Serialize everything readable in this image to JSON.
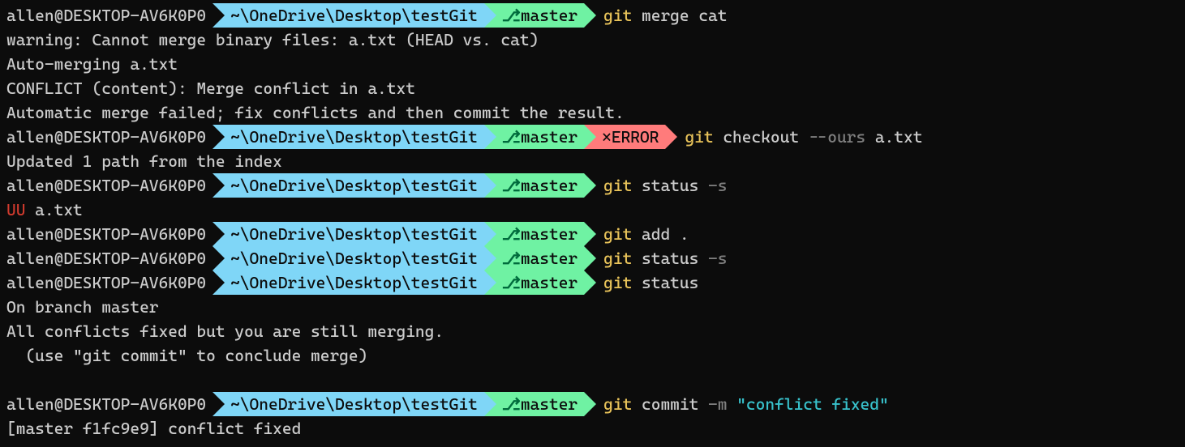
{
  "user": "allen@DESKTOP-AV6K0P0",
  "path": "~\\OneDrive\\Desktop\\testGit",
  "branch": "master",
  "error_badge": "⨯ERROR",
  "branch_glyph": "⎇",
  "cmds": {
    "c1_git": "git",
    "c1_sub": "merge cat",
    "c2_git": "git",
    "c2_sub": "checkout",
    "c2_flag": "--ours",
    "c2_arg": "a.txt",
    "c3_git": "git",
    "c3_sub": "status",
    "c3_flag": "-s",
    "c4_git": "git",
    "c4_sub": "add .",
    "c5_git": "git",
    "c5_sub": "status",
    "c5_flag": "-s",
    "c6_git": "git",
    "c6_sub": "status",
    "c7_git": "git",
    "c7_sub": "commit",
    "c7_flag": "-m",
    "c7_str": "\"conflict fixed\""
  },
  "out": {
    "o1": "warning: Cannot merge binary files: a.txt (HEAD vs. cat)",
    "o2": "Auto-merging a.txt",
    "o3": "CONFLICT (content): Merge conflict in a.txt",
    "o4": "Automatic merge failed; fix conflicts and then commit the result.",
    "o5": "Updated 1 path from the index",
    "o6_uu": "UU",
    "o6_file": " a.txt",
    "o7": "On branch master",
    "o8": "All conflicts fixed but you are still merging.",
    "o9": "  (use \"git commit\" to conclude merge)",
    "o10": "[master f1fc9e9] conflict fixed"
  }
}
